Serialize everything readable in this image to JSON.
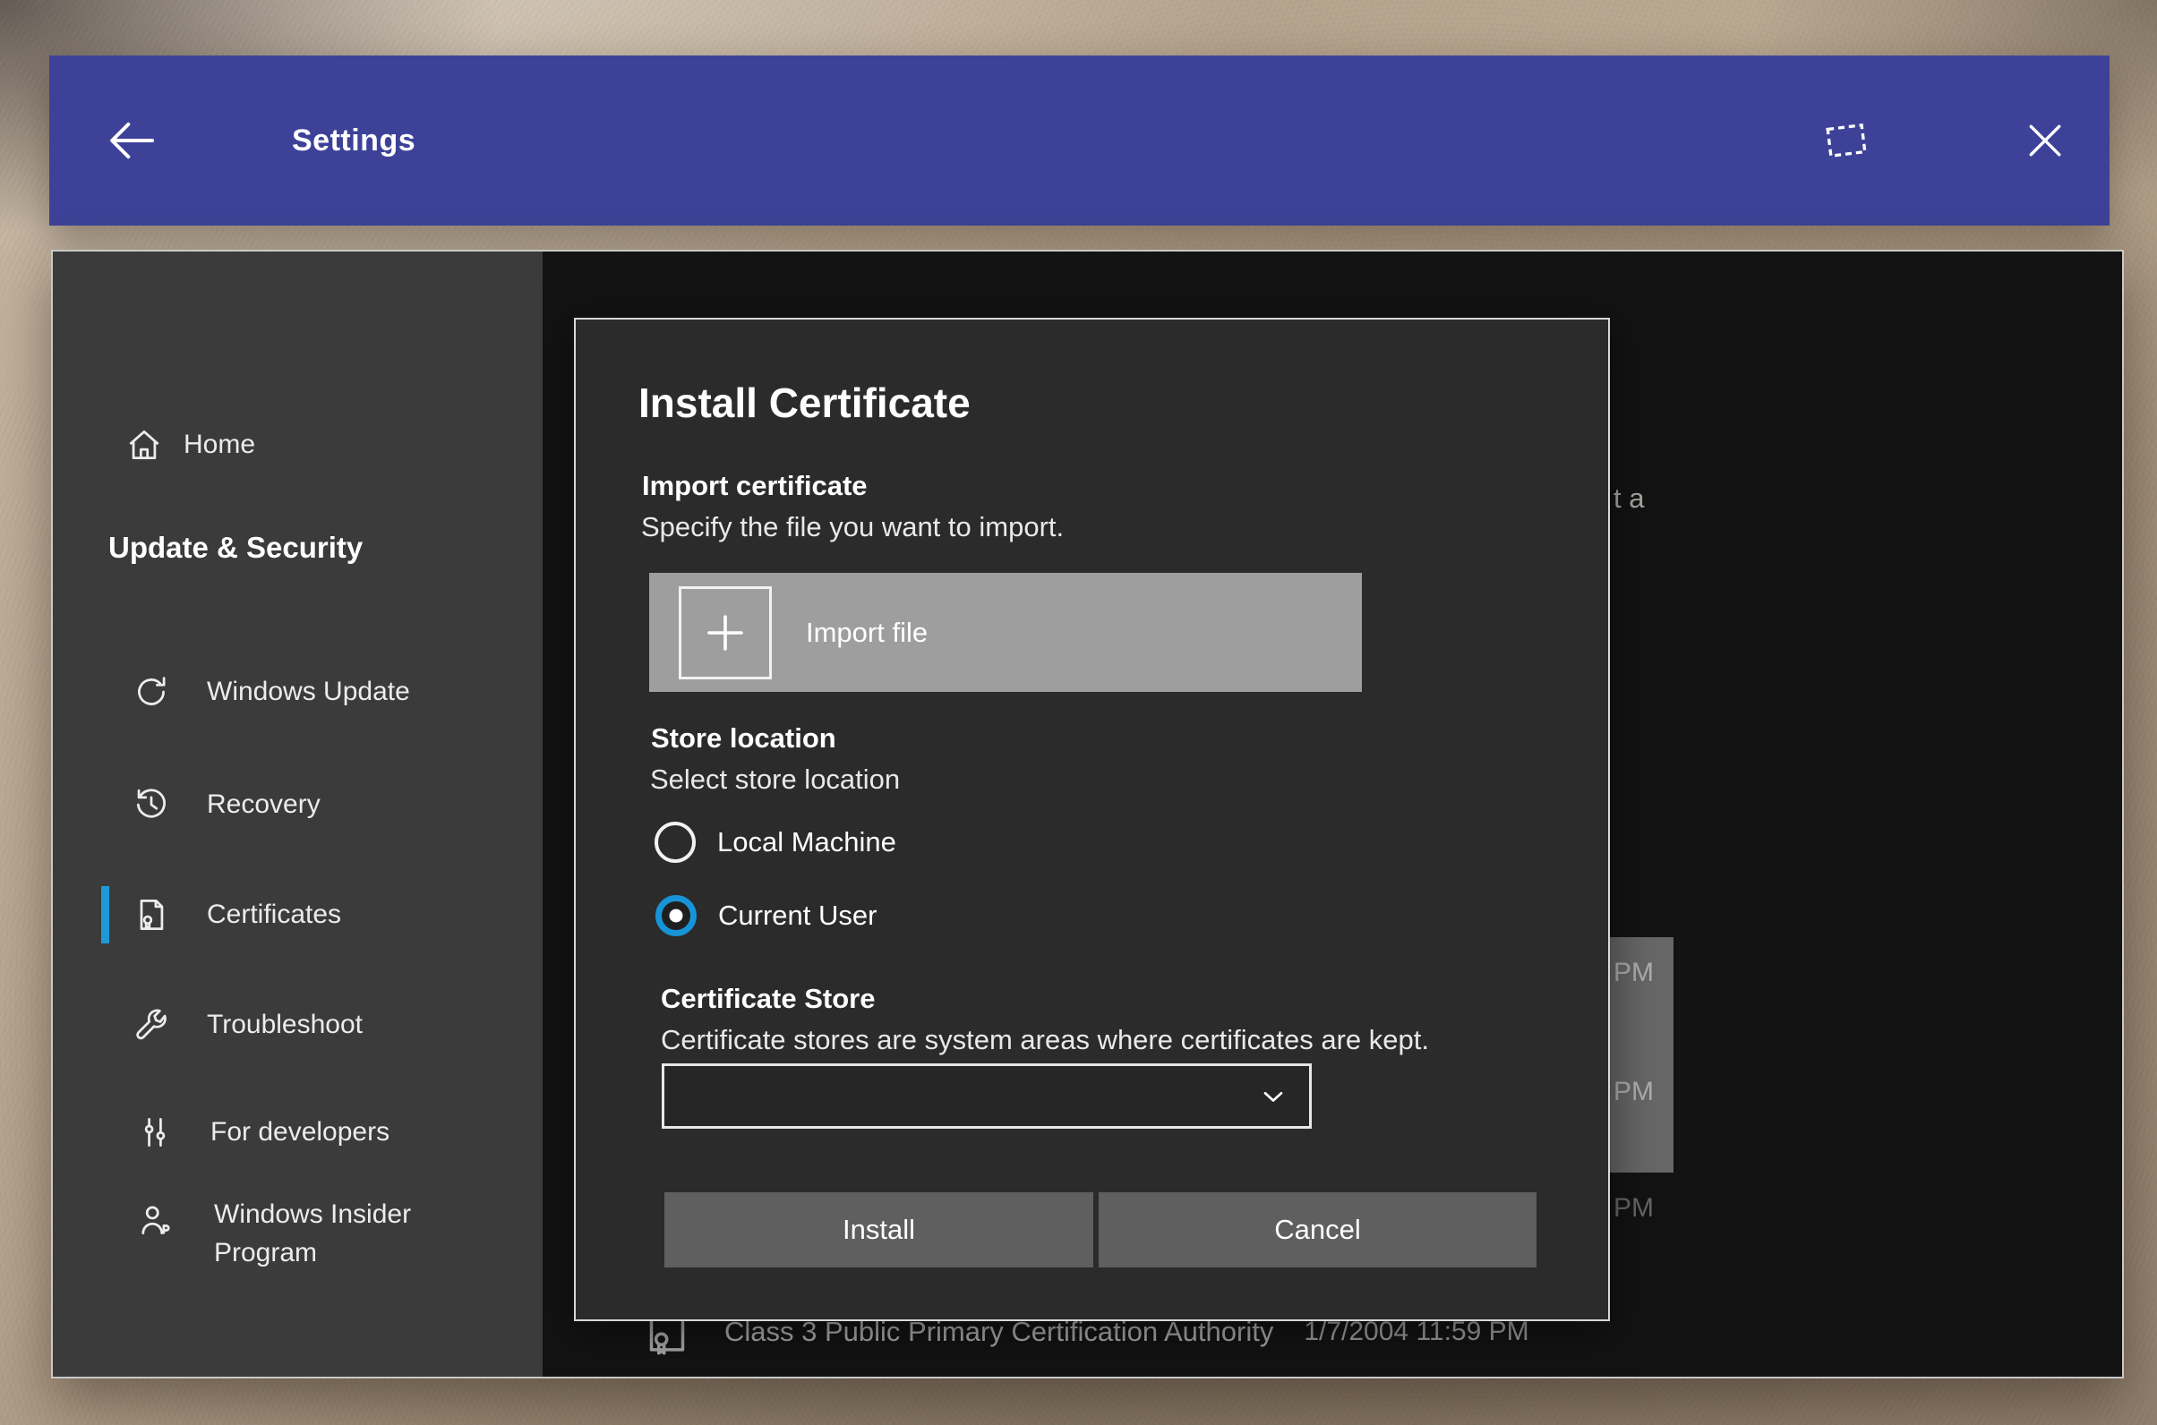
{
  "colors": {
    "titlebar_blue": "#3d4298",
    "accent_blue": "#1e9bd7",
    "sidebar_bg": "#3b3b3b",
    "content_bg": "#1b1b1b",
    "dialog_bg": "#2b2b2b"
  },
  "titlebar": {
    "title": "Settings",
    "back_icon": "arrow-left-icon",
    "window_icon": "dashed-window-icon",
    "close_icon": "close-x-icon"
  },
  "sidebar": {
    "items": [
      {
        "label": "Home",
        "icon": "home-icon",
        "selected": false
      },
      {
        "label": "Update & Security",
        "header": true
      },
      {
        "label": "Windows Update",
        "icon": "sync-icon",
        "selected": false
      },
      {
        "label": "Recovery",
        "icon": "history-icon",
        "selected": false
      },
      {
        "label": "Certificates",
        "icon": "certificate-icon",
        "selected": true
      },
      {
        "label": "Troubleshoot",
        "icon": "wrench-icon",
        "selected": false
      },
      {
        "label": "For developers",
        "icon": "dev-sliders-icon",
        "selected": false
      },
      {
        "label": "Windows Insider Program",
        "icon": "person-icon",
        "selected": false
      }
    ]
  },
  "dialog": {
    "title": "Install Certificate",
    "import_section": {
      "heading": "Import certificate",
      "description": "Specify the file you want to import.",
      "import_button": "Import file",
      "import_icon": "plus-icon"
    },
    "store_location": {
      "heading": "Store location",
      "description": "Select store location",
      "options": [
        {
          "label": "Local Machine",
          "selected": false
        },
        {
          "label": "Current User",
          "selected": true
        }
      ]
    },
    "certificate_store": {
      "heading": "Certificate Store",
      "description": "Certificate stores are system areas where certificates are kept.",
      "dropdown_value": "",
      "dropdown_icon": "chevron-down-icon"
    },
    "actions": {
      "install": "Install",
      "cancel": "Cancel"
    }
  },
  "background_list": {
    "occluded_text_fragment": "t a",
    "time_fragments": [
      "PM",
      "PM",
      "PM"
    ],
    "bottom_row": {
      "icon": "certificate-icon",
      "name": "Class 3 Public Primary Certification Authority",
      "date": "1/7/2004 11:59 PM"
    }
  }
}
